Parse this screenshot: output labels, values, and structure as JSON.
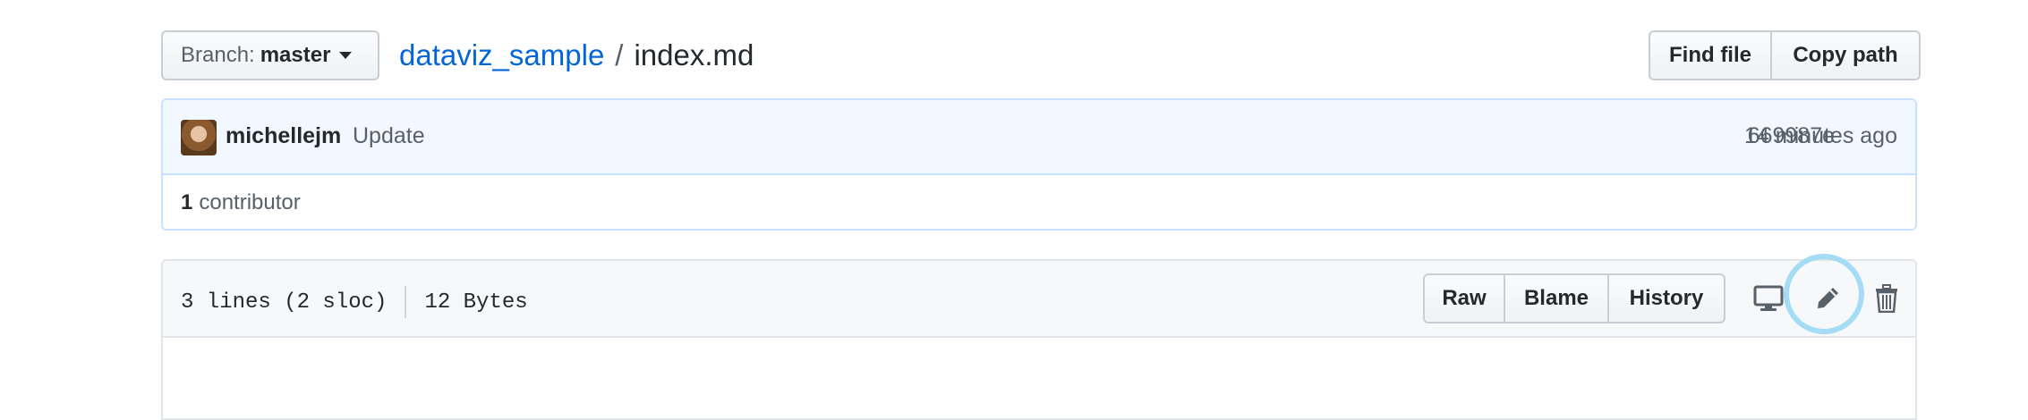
{
  "branch": {
    "label": "Branch:",
    "value": "master"
  },
  "breadcrumb": {
    "repo": "dataviz_sample",
    "separator": "/",
    "file": "index.md"
  },
  "header_buttons": {
    "find_file": "Find file",
    "copy_path": "Copy path"
  },
  "commit": {
    "author": "michellejm",
    "message": "Update",
    "sha": "669987e",
    "time": "14 minutes ago",
    "contributors_count": "1",
    "contributors_label": "contributor"
  },
  "file": {
    "lines": "3 lines (2 sloc)",
    "size": "12 Bytes",
    "actions": {
      "raw": "Raw",
      "blame": "Blame",
      "history": "History"
    },
    "icons": [
      "desktop-icon",
      "pencil-icon",
      "trash-icon"
    ]
  },
  "colors": {
    "link": "#0366d6",
    "highlight_ring": "#a4dcf5",
    "commit_bg": "#f1f8ff",
    "commit_border": "#c8e1ff"
  }
}
